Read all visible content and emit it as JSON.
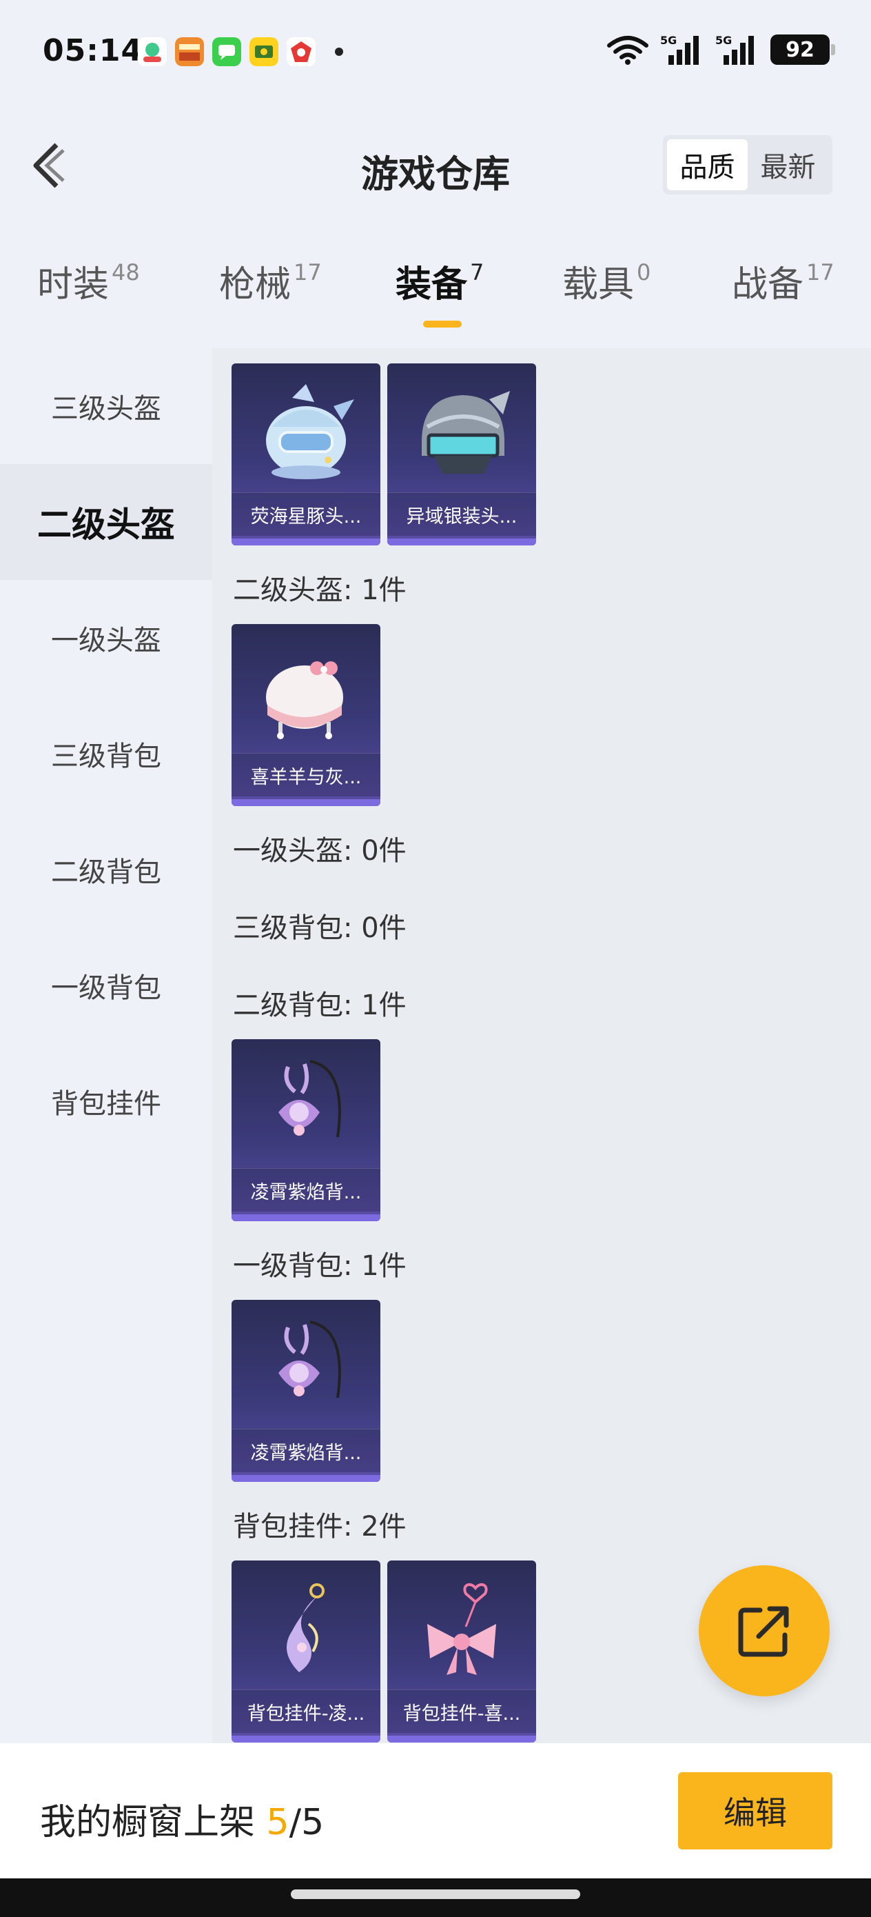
{
  "status": {
    "time": "05:14",
    "battery": "92",
    "signal_1": "5G",
    "signal_2": "5G"
  },
  "header": {
    "title": "游戏仓库",
    "sort": {
      "quality": "品质",
      "latest": "最新"
    }
  },
  "tabs": [
    {
      "label": "时装",
      "count": "48"
    },
    {
      "label": "枪械",
      "count": "17"
    },
    {
      "label": "装备",
      "count": "7"
    },
    {
      "label": "载具",
      "count": "0"
    },
    {
      "label": "战备",
      "count": "17"
    }
  ],
  "sidebar": {
    "items": [
      "三级头盔",
      "二级头盔",
      "一级头盔",
      "三级背包",
      "二级背包",
      "一级背包",
      "背包挂件"
    ]
  },
  "groups": [
    {
      "label": "二级头盔: 1件"
    },
    {
      "label": "一级头盔: 0件"
    },
    {
      "label": "三级背包: 0件"
    },
    {
      "label": "二级背包: 1件"
    },
    {
      "label": "一级背包: 1件"
    },
    {
      "label": "背包挂件: 2件"
    }
  ],
  "cards": [
    {
      "name": "荧海星豚头...",
      "icon": "dolphin-helmet-icon"
    },
    {
      "name": "异域银装头...",
      "icon": "silver-helmet-icon"
    },
    {
      "name": "喜羊羊与灰...",
      "icon": "pink-helmet-icon"
    },
    {
      "name": "凌霄紫焰背...",
      "icon": "purple-backpack-icon"
    },
    {
      "name": "凌霄紫焰背...",
      "icon": "purple-backpack-icon"
    },
    {
      "name": "背包挂件-凌...",
      "icon": "charm-icon"
    },
    {
      "name": "背包挂件-喜...",
      "icon": "bow-charm-icon"
    }
  ],
  "bottom": {
    "showcase_label": "我的橱窗上架",
    "listed": "5",
    "separator": "/",
    "total": "5",
    "edit": "编辑"
  },
  "colors": {
    "accent": "#fbb51c",
    "card_bg": "#3b3a7a",
    "background": "#eef2f8"
  }
}
